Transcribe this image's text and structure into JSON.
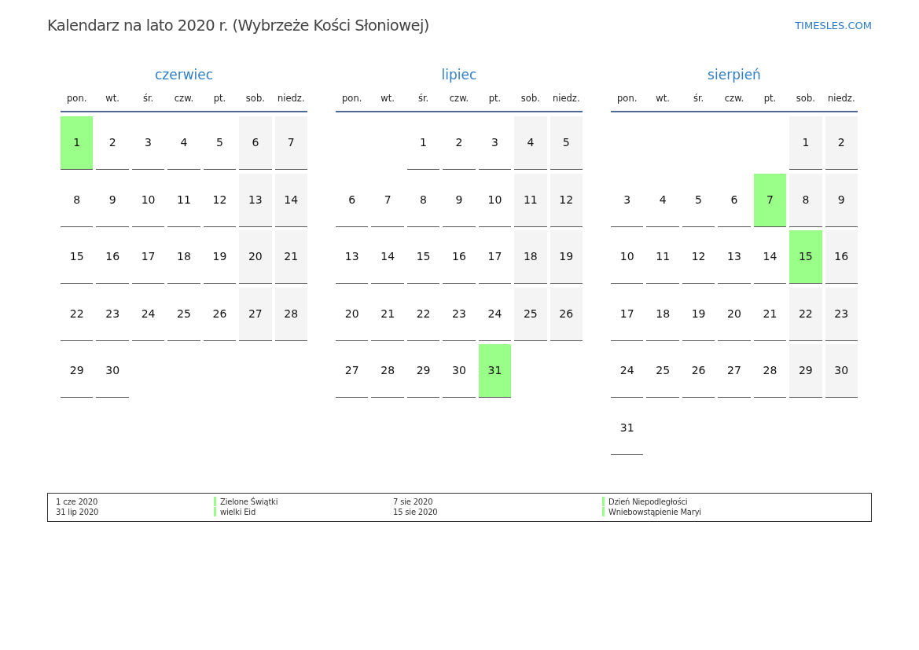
{
  "title": "Kalendarz na lato 2020 r. (Wybrzeże Kości Słoniowej)",
  "site": "TIMESLES.COM",
  "months": [
    {
      "name": "czerwiec",
      "weekdays": [
        "pon.",
        "wt.",
        "śr.",
        "czw.",
        "pt.",
        "sob.",
        "niedz."
      ],
      "weeks": [
        [
          {
            "day": "1",
            "kind": "weekday",
            "holiday": true
          },
          {
            "day": "2",
            "kind": "weekday",
            "holiday": false
          },
          {
            "day": "3",
            "kind": "weekday",
            "holiday": false
          },
          {
            "day": "4",
            "kind": "weekday",
            "holiday": false
          },
          {
            "day": "5",
            "kind": "weekday",
            "holiday": false
          },
          {
            "day": "6",
            "kind": "weekend",
            "holiday": false
          },
          {
            "day": "7",
            "kind": "weekend",
            "holiday": false
          }
        ],
        [
          {
            "day": "8",
            "kind": "weekday",
            "holiday": false
          },
          {
            "day": "9",
            "kind": "weekday",
            "holiday": false
          },
          {
            "day": "10",
            "kind": "weekday",
            "holiday": false
          },
          {
            "day": "11",
            "kind": "weekday",
            "holiday": false
          },
          {
            "day": "12",
            "kind": "weekday",
            "holiday": false
          },
          {
            "day": "13",
            "kind": "weekend",
            "holiday": false
          },
          {
            "day": "14",
            "kind": "weekend",
            "holiday": false
          }
        ],
        [
          {
            "day": "15",
            "kind": "weekday",
            "holiday": false
          },
          {
            "day": "16",
            "kind": "weekday",
            "holiday": false
          },
          {
            "day": "17",
            "kind": "weekday",
            "holiday": false
          },
          {
            "day": "18",
            "kind": "weekday",
            "holiday": false
          },
          {
            "day": "19",
            "kind": "weekday",
            "holiday": false
          },
          {
            "day": "20",
            "kind": "weekend",
            "holiday": false
          },
          {
            "day": "21",
            "kind": "weekend",
            "holiday": false
          }
        ],
        [
          {
            "day": "22",
            "kind": "weekday",
            "holiday": false
          },
          {
            "day": "23",
            "kind": "weekday",
            "holiday": false
          },
          {
            "day": "24",
            "kind": "weekday",
            "holiday": false
          },
          {
            "day": "25",
            "kind": "weekday",
            "holiday": false
          },
          {
            "day": "26",
            "kind": "weekday",
            "holiday": false
          },
          {
            "day": "27",
            "kind": "weekend",
            "holiday": false
          },
          {
            "day": "28",
            "kind": "weekend",
            "holiday": false
          }
        ],
        [
          {
            "day": "29",
            "kind": "weekday",
            "holiday": false
          },
          {
            "day": "30",
            "kind": "weekday",
            "holiday": false
          }
        ]
      ]
    },
    {
      "name": "lipiec",
      "weekdays": [
        "pon.",
        "wt.",
        "śr.",
        "czw.",
        "pt.",
        "sob.",
        "niedz."
      ],
      "weeks": [
        [
          {
            "kind": "blank"
          },
          {
            "kind": "blank"
          },
          {
            "day": "1",
            "kind": "weekday",
            "holiday": false
          },
          {
            "day": "2",
            "kind": "weekday",
            "holiday": false
          },
          {
            "day": "3",
            "kind": "weekday",
            "holiday": false
          },
          {
            "day": "4",
            "kind": "weekend",
            "holiday": false
          },
          {
            "day": "5",
            "kind": "weekend",
            "holiday": false
          }
        ],
        [
          {
            "day": "6",
            "kind": "weekday",
            "holiday": false
          },
          {
            "day": "7",
            "kind": "weekday",
            "holiday": false
          },
          {
            "day": "8",
            "kind": "weekday",
            "holiday": false
          },
          {
            "day": "9",
            "kind": "weekday",
            "holiday": false
          },
          {
            "day": "10",
            "kind": "weekday",
            "holiday": false
          },
          {
            "day": "11",
            "kind": "weekend",
            "holiday": false
          },
          {
            "day": "12",
            "kind": "weekend",
            "holiday": false
          }
        ],
        [
          {
            "day": "13",
            "kind": "weekday",
            "holiday": false
          },
          {
            "day": "14",
            "kind": "weekday",
            "holiday": false
          },
          {
            "day": "15",
            "kind": "weekday",
            "holiday": false
          },
          {
            "day": "16",
            "kind": "weekday",
            "holiday": false
          },
          {
            "day": "17",
            "kind": "weekday",
            "holiday": false
          },
          {
            "day": "18",
            "kind": "weekend",
            "holiday": false
          },
          {
            "day": "19",
            "kind": "weekend",
            "holiday": false
          }
        ],
        [
          {
            "day": "20",
            "kind": "weekday",
            "holiday": false
          },
          {
            "day": "21",
            "kind": "weekday",
            "holiday": false
          },
          {
            "day": "22",
            "kind": "weekday",
            "holiday": false
          },
          {
            "day": "23",
            "kind": "weekday",
            "holiday": false
          },
          {
            "day": "24",
            "kind": "weekday",
            "holiday": false
          },
          {
            "day": "25",
            "kind": "weekend",
            "holiday": false
          },
          {
            "day": "26",
            "kind": "weekend",
            "holiday": false
          }
        ],
        [
          {
            "day": "27",
            "kind": "weekday",
            "holiday": false
          },
          {
            "day": "28",
            "kind": "weekday",
            "holiday": false
          },
          {
            "day": "29",
            "kind": "weekday",
            "holiday": false
          },
          {
            "day": "30",
            "kind": "weekday",
            "holiday": false
          },
          {
            "day": "31",
            "kind": "weekday",
            "holiday": true
          }
        ]
      ]
    },
    {
      "name": "sierpień",
      "weekdays": [
        "pon.",
        "wt.",
        "śr.",
        "czw.",
        "pt.",
        "sob.",
        "niedz."
      ],
      "weeks": [
        [
          {
            "kind": "blank"
          },
          {
            "kind": "blank"
          },
          {
            "kind": "blank"
          },
          {
            "kind": "blank"
          },
          {
            "kind": "blank"
          },
          {
            "day": "1",
            "kind": "weekend",
            "holiday": false
          },
          {
            "day": "2",
            "kind": "weekend",
            "holiday": false
          }
        ],
        [
          {
            "day": "3",
            "kind": "weekday",
            "holiday": false
          },
          {
            "day": "4",
            "kind": "weekday",
            "holiday": false
          },
          {
            "day": "5",
            "kind": "weekday",
            "holiday": false
          },
          {
            "day": "6",
            "kind": "weekday",
            "holiday": false
          },
          {
            "day": "7",
            "kind": "weekday",
            "holiday": true
          },
          {
            "day": "8",
            "kind": "weekend",
            "holiday": false
          },
          {
            "day": "9",
            "kind": "weekend",
            "holiday": false
          }
        ],
        [
          {
            "day": "10",
            "kind": "weekday",
            "holiday": false
          },
          {
            "day": "11",
            "kind": "weekday",
            "holiday": false
          },
          {
            "day": "12",
            "kind": "weekday",
            "holiday": false
          },
          {
            "day": "13",
            "kind": "weekday",
            "holiday": false
          },
          {
            "day": "14",
            "kind": "weekday",
            "holiday": false
          },
          {
            "day": "15",
            "kind": "weekend",
            "holiday": true
          },
          {
            "day": "16",
            "kind": "weekend",
            "holiday": false
          }
        ],
        [
          {
            "day": "17",
            "kind": "weekday",
            "holiday": false
          },
          {
            "day": "18",
            "kind": "weekday",
            "holiday": false
          },
          {
            "day": "19",
            "kind": "weekday",
            "holiday": false
          },
          {
            "day": "20",
            "kind": "weekday",
            "holiday": false
          },
          {
            "day": "21",
            "kind": "weekday",
            "holiday": false
          },
          {
            "day": "22",
            "kind": "weekend",
            "holiday": false
          },
          {
            "day": "23",
            "kind": "weekend",
            "holiday": false
          }
        ],
        [
          {
            "day": "24",
            "kind": "weekday",
            "holiday": false
          },
          {
            "day": "25",
            "kind": "weekday",
            "holiday": false
          },
          {
            "day": "26",
            "kind": "weekday",
            "holiday": false
          },
          {
            "day": "27",
            "kind": "weekday",
            "holiday": false
          },
          {
            "day": "28",
            "kind": "weekday",
            "holiday": false
          },
          {
            "day": "29",
            "kind": "weekend",
            "holiday": false
          },
          {
            "day": "30",
            "kind": "weekend",
            "holiday": false
          }
        ],
        [
          {
            "day": "31",
            "kind": "weekday",
            "holiday": false
          }
        ]
      ]
    }
  ],
  "legend_columns": [
    [
      {
        "date": "1 cze 2020",
        "name": "Zielone Świątki"
      },
      {
        "date": "31 lip 2020",
        "name": "wielki Eid"
      }
    ],
    [
      {
        "date": "7 sie 2020",
        "name": "Dzień Niepodległości"
      },
      {
        "date": "15 sie 2020",
        "name": "Wniebowstąpienie Maryi"
      }
    ]
  ]
}
